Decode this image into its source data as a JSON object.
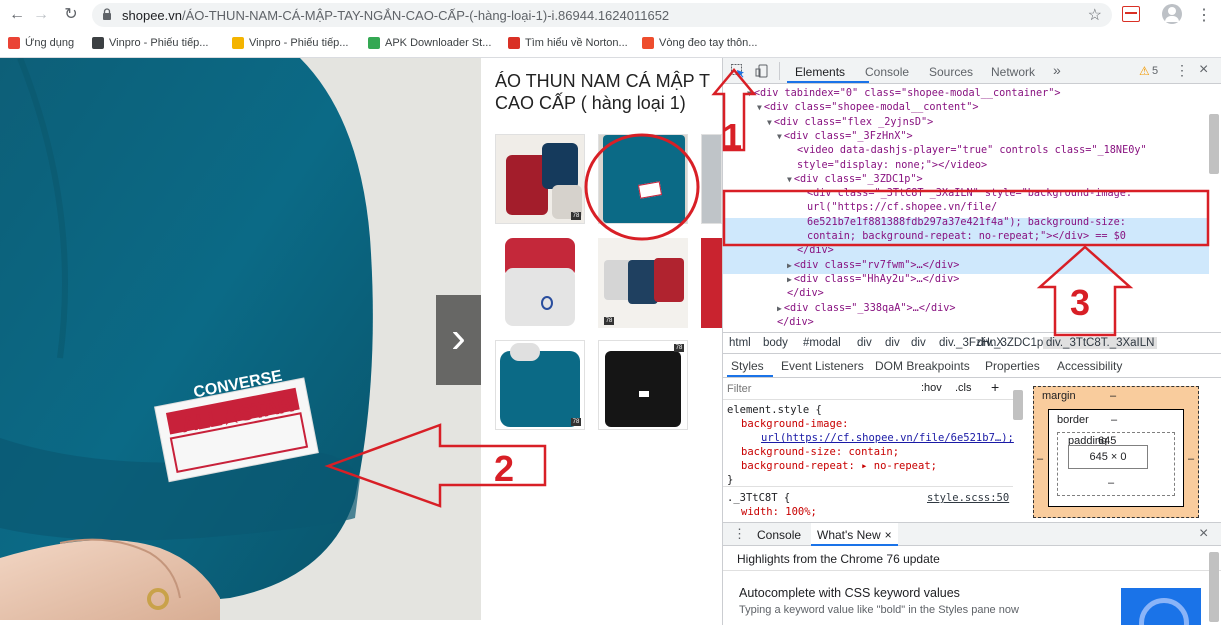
{
  "browser": {
    "url_host": "shopee.vn",
    "url_path": "/ÁO-THUN-NAM-CÁ-MẬP-TAY-NGẮN-CAO-CẤP-(-hàng-loại-1)-i.86944.1624011652",
    "bookmarks": [
      {
        "label": "Ứng dụng",
        "icon": "apps-grid-icon",
        "color": "#ea4335"
      },
      {
        "label": "Vinpro - Phiếu tiếp...",
        "icon": "vinpro-icon",
        "color": "#3c4043"
      },
      {
        "label": "Vinpro - Phiếu tiếp...",
        "icon": "vinpro-icon",
        "color": "#f4b400"
      },
      {
        "label": "APK Downloader St...",
        "icon": "apk-icon",
        "color": "#34a853"
      },
      {
        "label": "Tìm hiểu về Norton...",
        "icon": "norton-icon",
        "color": "#d93025"
      },
      {
        "label": "Vòng đeo tay thôn...",
        "icon": "shopee-icon",
        "color": "#ee4d2d"
      }
    ]
  },
  "product": {
    "title_line1": "ÁO THUN NAM CÁ MẬP T",
    "title_line2": "CAO CẤP ( hàng loại 1)",
    "photo_label_top": "CONVERSE",
    "photo_label_bottom": "ALL★STAR",
    "thumb_badge": "78"
  },
  "annotations": {
    "n1": "1",
    "n2": "2",
    "n3": "3"
  },
  "devtools": {
    "tabs": [
      "Elements",
      "Console",
      "Sources",
      "Network"
    ],
    "more": "»",
    "warnings": "5",
    "dom_lines": [
      {
        "indent": 0,
        "arrow": "▼",
        "html": "<div tabindex=\"0\" class=\"shopee-modal__container\">"
      },
      {
        "indent": 1,
        "arrow": "▼",
        "html": "<div class=\"shopee-modal__content\">"
      },
      {
        "indent": 2,
        "arrow": "▼",
        "html": "<div class=\"flex _2yjnsD\">"
      },
      {
        "indent": 3,
        "arrow": "▼",
        "html": "<div class=\"_3FzHnX\">"
      },
      {
        "indent": 4,
        "arrow": "",
        "html": "<video data-dashjs-player=\"true\" controls class=\"_18NE0y\""
      },
      {
        "indent": 4,
        "arrow": "",
        "html": "style=\"display: none;\"></video>"
      },
      {
        "indent": 4,
        "arrow": "▼",
        "html": "<div class=\"_3ZDC1p\">"
      },
      {
        "indent": 5,
        "arrow": "",
        "html": "<div class=\"_3TtC8T _3XaILN\" style=\"background-image:"
      },
      {
        "indent": 5,
        "arrow": "",
        "html": "url(\"https://cf.shopee.vn/file/"
      },
      {
        "indent": 5,
        "arrow": "",
        "html": "6e521b7e1f881388fdb297a37e421f4a\"); background-size:"
      },
      {
        "indent": 5,
        "arrow": "",
        "html": "contain; background-repeat: no-repeat;\"></div> == $0"
      },
      {
        "indent": 4,
        "arrow": "",
        "html": "</div>"
      },
      {
        "indent": 4,
        "arrow": "▶",
        "html": "<div class=\"rv7fwm\">…</div>"
      },
      {
        "indent": 4,
        "arrow": "▶",
        "html": "<div class=\"HhAy2u\">…</div>"
      },
      {
        "indent": 3,
        "arrow": "",
        "html": "</div>"
      },
      {
        "indent": 3,
        "arrow": "▶",
        "html": "<div class=\"_338qaA\">…</div>"
      },
      {
        "indent": 2,
        "arrow": "",
        "html": "</div>"
      }
    ],
    "breadcrumbs": [
      "html",
      "body",
      "#modal",
      "div",
      "div",
      "div",
      "div._3FzHnX",
      "div._3ZDC1p",
      "div._3TtC8T._3XaILN"
    ],
    "style_tabs": [
      "Styles",
      "Event Listeners",
      "DOM Breakpoints",
      "Properties",
      "Accessibility"
    ],
    "filter_placeholder": "Filter",
    "hov": ":hov",
    "cls": ".cls",
    "plus": "+",
    "css_lines": [
      "element.style {",
      "background-image:",
      "url(https://cf.shopee.vn/file/6e521b7…);",
      "background-size: contain;",
      "background-repeat: ▸ no-repeat;",
      "}",
      "._3TtC8T {",
      "width: 100%;"
    ],
    "css_source": "style.scss:50",
    "box_model": {
      "margin": "margin",
      "border": "border",
      "padding": "padding",
      "padding_val": "645",
      "content": "645 × 0",
      "dash": "–"
    },
    "drawer_tabs": [
      "Console",
      "What's New"
    ],
    "drawer_close": "×",
    "whats_new_title": "Highlights from the Chrome 76 update",
    "feature_title": "Autocomplete with CSS keyword values",
    "feature_desc": "Typing a keyword value like \"bold\" in the Styles pane now"
  }
}
